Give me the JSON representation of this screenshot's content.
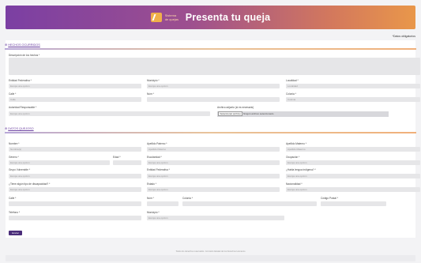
{
  "header": {
    "brand": "Sistema de quejas",
    "title": "Presenta tu queja"
  },
  "required_note": "*Datos obligatorios",
  "sections": {
    "hechos": "HECHOS OCURRIDOS",
    "datos": "DATOS QUEJOSO"
  },
  "placeholder": "Escoja una opción",
  "hechos": {
    "descripcion": "Descripción de los hechos *",
    "entidad": "Entidad Federativa *",
    "municipio": "Municipio *",
    "localidad": "Localidad *",
    "localidad_ph": "Localidad",
    "calle": "Calle *",
    "calle_ph": "Calle",
    "num": "Núm *",
    "colonia": "Colonia *",
    "colonia_ph": "Colonia",
    "autoridad": "Autoridad Responsable *",
    "archivo": "Archivo adjunto (si es necesario)",
    "file_btn": "Seleccionar archivo",
    "file_none": "Ningún archivo seleccionado"
  },
  "datos": {
    "nombre": "Nombre *",
    "nombre_ph": "Nombre(s)",
    "ap_pat": "Apellido Paterno *",
    "ap_pat_ph": "Apellido Paterno",
    "ap_mat": "Apellido Materno *",
    "ap_mat_ph": "Apellido Materno",
    "genero": "Género *",
    "edad": "Edad *",
    "escolaridad": "Escolaridad *",
    "ocupacion": "Ocupación *",
    "grupo": "Grupo Vulnerable *",
    "entidad_nac": "Entidad Federativa *",
    "lengua": "¿Habla lengua indígena? *",
    "discap": "¿Tiene algún tipo de discapacidad? *",
    "estado": "Estado *",
    "nacionalidad": "Nacionalidad *",
    "calle": "Calle *",
    "num": "Núm *",
    "colonia": "Colonia *",
    "cp": "Código Postal *",
    "telefono": "Teléfono *",
    "municipio": "Municipio *"
  },
  "submit": "Enviar",
  "footer": "Todos los derechos reservados. Comisión Estatal de los Derechos Humanos"
}
